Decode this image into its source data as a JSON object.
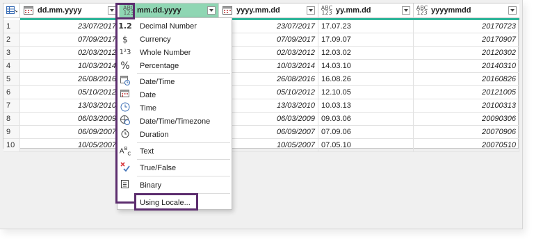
{
  "columns": [
    {
      "type_icon": "table-grid",
      "name": "dd.mm.yyyy"
    },
    {
      "type_icon": "ABC 123",
      "name": "mm.dd.yyyy"
    },
    {
      "type_icon": "table-grid",
      "name": "yyyy.mm.dd"
    },
    {
      "type_icon": "ABC 123",
      "name": "yy.mm.dd"
    },
    {
      "type_icon": "ABC 123",
      "name": "yyyymmdd"
    }
  ],
  "rows": [
    {
      "n": "1",
      "c1": "23/07/2017",
      "c3": "23/07/2017",
      "c4": "17.07.23",
      "c5": "20170723"
    },
    {
      "n": "2",
      "c1": "07/09/2017",
      "c3": "07/09/2017",
      "c4": "17.09.07",
      "c5": "20170907"
    },
    {
      "n": "3",
      "c1": "02/03/2012",
      "c3": "02/03/2012",
      "c4": "12.03.02",
      "c5": "20120302"
    },
    {
      "n": "4",
      "c1": "10/03/2014",
      "c3": "10/03/2014",
      "c4": "14.03.10",
      "c5": "20140310"
    },
    {
      "n": "5",
      "c1": "26/08/2016",
      "c3": "26/08/2016",
      "c4": "16.08.26",
      "c5": "20160826"
    },
    {
      "n": "6",
      "c1": "05/10/2012",
      "c3": "05/10/2012",
      "c4": "12.10.05",
      "c5": "20121005"
    },
    {
      "n": "7",
      "c1": "13/03/2010",
      "c3": "13/03/2010",
      "c4": "10.03.13",
      "c5": "20100313"
    },
    {
      "n": "8",
      "c1": "06/03/2009",
      "c3": "06/03/2009",
      "c4": "09.03.06",
      "c5": "20090306"
    },
    {
      "n": "9",
      "c1": "06/09/2007",
      "c3": "06/09/2007",
      "c4": "07.09.06",
      "c5": "20070906"
    },
    {
      "n": "10",
      "c1": "10/05/2007",
      "c3": "10/05/2007",
      "c4": "07.05.10",
      "c5": "20070510"
    }
  ],
  "menu": {
    "items": [
      {
        "icon": "1.2",
        "label": "Decimal Number"
      },
      {
        "icon": "$",
        "label": "Currency"
      },
      {
        "icon": "1²3",
        "label": "Whole Number"
      },
      {
        "icon": "%",
        "label": "Percentage"
      },
      {
        "icon": "datetime-icon",
        "label": "Date/Time"
      },
      {
        "icon": "date-icon",
        "label": "Date"
      },
      {
        "icon": "time-icon",
        "label": "Time"
      },
      {
        "icon": "timezone-icon",
        "label": "Date/Time/Timezone"
      },
      {
        "icon": "duration-icon",
        "label": "Duration"
      },
      {
        "icon": "text-icon",
        "label": "Text"
      },
      {
        "icon": "truefalse-icon",
        "label": "True/False"
      },
      {
        "icon": "binary-icon",
        "label": "Binary"
      },
      {
        "icon": "",
        "label": "Using Locale..."
      }
    ]
  },
  "colors": {
    "selected_header": "#8fd6b3",
    "highlight": "#5c2d6e",
    "accent": "#2fb59a"
  }
}
